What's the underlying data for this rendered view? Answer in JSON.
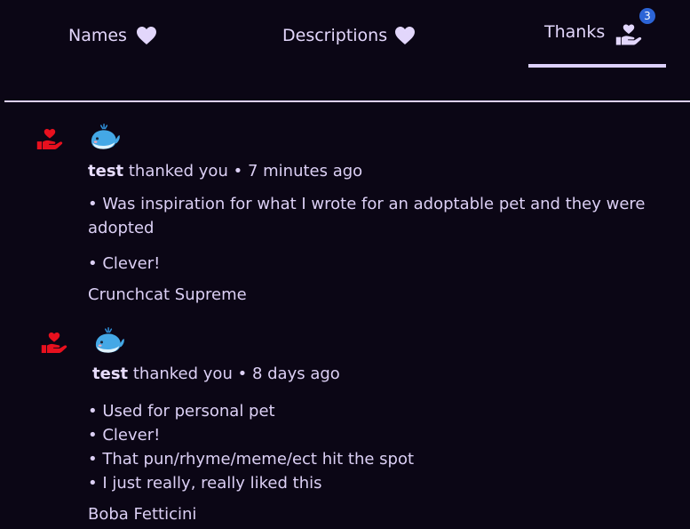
{
  "tabs": [
    {
      "label": "Names",
      "icon": "heart-icon",
      "active": false
    },
    {
      "label": "Descriptions",
      "icon": "heart-icon",
      "active": false
    },
    {
      "label": "Thanks",
      "icon": "heart-hand-icon",
      "active": true,
      "badge": "3"
    }
  ],
  "colors": {
    "background": "#0b0615",
    "text": "#dcd0f5",
    "accent": "#ddd0fb",
    "badge": "#2c64d6",
    "thanks_icon": "#e8101e"
  },
  "entries": [
    {
      "user": "test",
      "action": "thanked you",
      "separator": "•",
      "time": "7 minutes ago",
      "reasons": [
        "• Was inspiration for what I wrote for an adoptable pet and they were adopted",
        "• Clever!"
      ],
      "name": "Crunchcat Supreme",
      "avatar_icon": "whale-icon",
      "thanks_icon": "heart-hand-icon"
    },
    {
      "user": "test",
      "action": "thanked you",
      "separator": "•",
      "time": "8 days ago",
      "reasons": [
        "• Used for personal pet",
        "• Clever!",
        "• That pun/rhyme/meme/ect hit the spot",
        "• I just really, really liked this"
      ],
      "name": "Boba Fetticini",
      "avatar_icon": "whale-icon",
      "thanks_icon": "heart-hand-icon"
    }
  ]
}
